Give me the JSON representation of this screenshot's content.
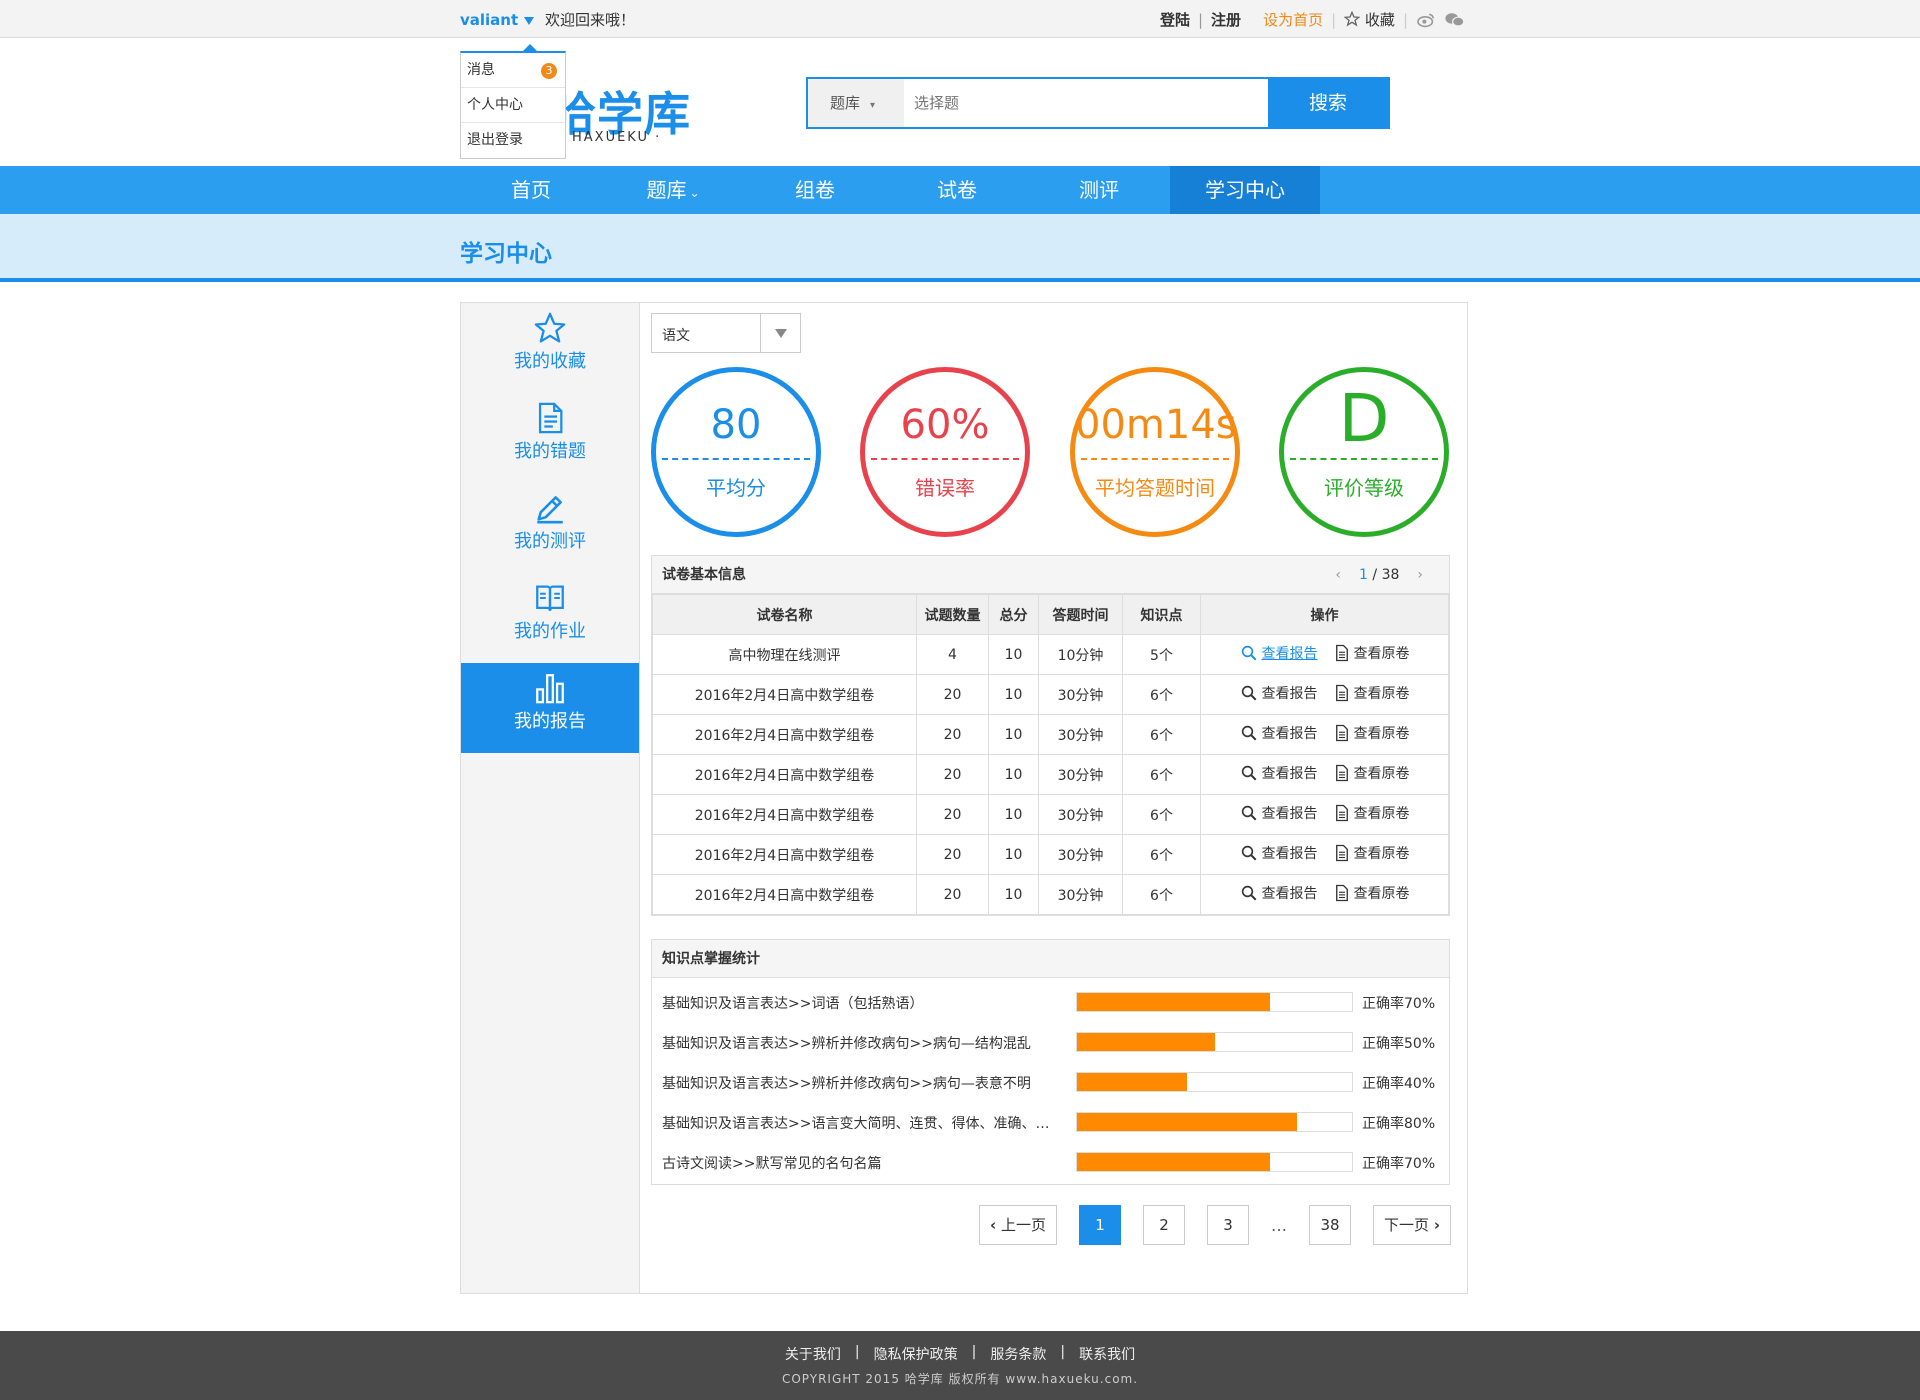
{
  "topbar": {
    "username": "valiant",
    "welcome": "欢迎回来哦！",
    "login": "登陆",
    "register": "注册",
    "set_home": "设为首页",
    "favorite": "收藏",
    "social": [
      "weibo-icon",
      "wechat-icon"
    ]
  },
  "user_menu": {
    "items": [
      {
        "label": "消息",
        "badge": "3"
      },
      {
        "label": "个人中心"
      },
      {
        "label": "退出登录"
      }
    ]
  },
  "logo": {
    "name": "哈学库",
    "name_visible": "哈学库",
    "subtitle": "HAXUEKU ·"
  },
  "search": {
    "category": "题库",
    "placeholder": "选择题",
    "button": "搜索"
  },
  "nav": {
    "items": [
      {
        "label": "首页"
      },
      {
        "label": "题库",
        "has_dropdown": true
      },
      {
        "label": "组卷"
      },
      {
        "label": "试卷"
      },
      {
        "label": "测评"
      },
      {
        "label": "学习中心",
        "active": true
      }
    ]
  },
  "page_title": "学习中心",
  "sidebar": {
    "items": [
      {
        "label": "我的收藏",
        "icon": "star-icon"
      },
      {
        "label": "我的错题",
        "icon": "document-icon"
      },
      {
        "label": "我的测评",
        "icon": "pencil-icon"
      },
      {
        "label": "我的作业",
        "icon": "book-icon"
      },
      {
        "label": "我的报告",
        "icon": "bar-chart-icon",
        "active": true
      }
    ]
  },
  "subject_select": {
    "value": "语文"
  },
  "stats": [
    {
      "value": "80",
      "label": "平均分",
      "color": "#1a8ee8"
    },
    {
      "value": "60%",
      "label": "错误率",
      "color": "#e8434d"
    },
    {
      "value": "00m14s",
      "label": "平均答题时间",
      "color": "#f58a12"
    },
    {
      "value": "D",
      "label": "评价等级",
      "color": "#2aae2a"
    }
  ],
  "paper_table": {
    "title": "试卷基本信息",
    "page_current": "1",
    "page_total": "/ 38",
    "headers": [
      "试卷名称",
      "试题数量",
      "总分",
      "答题时间",
      "知识点",
      "操作"
    ],
    "op_report": "查看报告",
    "op_original": "查看原卷",
    "rows": [
      {
        "name": "高中物理在线测评",
        "count": "4",
        "score": "10",
        "time": "10分钟",
        "points": "5个"
      },
      {
        "name": "2016年2月4日高中数学组卷",
        "count": "20",
        "score": "10",
        "time": "30分钟",
        "points": "6个"
      },
      {
        "name": "2016年2月4日高中数学组卷",
        "count": "20",
        "score": "10",
        "time": "30分钟",
        "points": "6个"
      },
      {
        "name": "2016年2月4日高中数学组卷",
        "count": "20",
        "score": "10",
        "time": "30分钟",
        "points": "6个"
      },
      {
        "name": "2016年2月4日高中数学组卷",
        "count": "20",
        "score": "10",
        "time": "30分钟",
        "points": "6个"
      },
      {
        "name": "2016年2月4日高中数学组卷",
        "count": "20",
        "score": "10",
        "time": "30分钟",
        "points": "6个"
      },
      {
        "name": "2016年2月4日高中数学组卷",
        "count": "20",
        "score": "10",
        "time": "30分钟",
        "points": "6个"
      }
    ]
  },
  "knowledge": {
    "title": "知识点掌握统计",
    "items": [
      {
        "name": "基础知识及语言表达>>词语（包括熟语）",
        "rate_label": "正确率70%",
        "rate": 0.7
      },
      {
        "name": "基础知识及语言表达>>辨析并修改病句>>病句—结构混乱",
        "rate_label": "正确率50%",
        "rate": 0.5
      },
      {
        "name": "基础知识及语言表达>>辨析并修改病句>>病句—表意不明",
        "rate_label": "正确率40%",
        "rate": 0.4
      },
      {
        "name": "基础知识及语言表达>>语言变大简明、连贯、得体、准确、…",
        "rate_label": "正确率80%",
        "rate": 0.8
      },
      {
        "name": "古诗文阅读>>默写常见的名句名篇",
        "rate_label": "正确率70%",
        "rate": 0.7
      }
    ]
  },
  "pagination": {
    "prev": "上一页",
    "pages": [
      "1",
      "2",
      "3"
    ],
    "ellipsis": "…",
    "last": "38",
    "next": "下一页",
    "current": "1"
  },
  "footer": {
    "links": [
      "关于我们",
      "隐私保护政策",
      "服务条款",
      "联系我们"
    ],
    "separator": "|",
    "copyright": "COPYRIGHT 2015  哈学库  版权所有  www.haxueku.com."
  }
}
